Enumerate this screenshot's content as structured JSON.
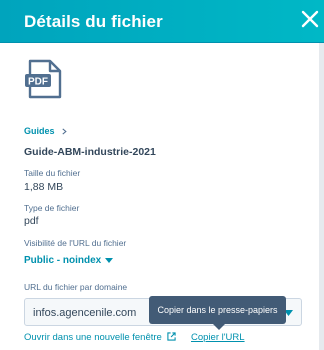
{
  "panel": {
    "title": "Détails du fichier",
    "close_icon": "close-icon"
  },
  "file": {
    "icon": "pdf-file-icon",
    "icon_text": "PDF",
    "breadcrumb": "Guides",
    "name": "Guide-ABM-industrie-2021",
    "size_label": "Taille du fichier",
    "size_value": "1,88 MB",
    "type_label": "Type de fichier",
    "type_value": "pdf"
  },
  "visibility": {
    "label": "Visibilité de l'URL du fichier",
    "value": "Public - noindex"
  },
  "domain": {
    "label": "URL du fichier par domaine",
    "selected": "infos.agencenile.com"
  },
  "tooltip": {
    "text": "Copier dans le presse-papiers"
  },
  "actions": {
    "open_new_window": "Ouvrir dans une nouvelle fenêtre",
    "copy_url": "Copier l'URL"
  },
  "colors": {
    "header": "#00a4bd",
    "link": "#0091ae",
    "text": "#33475b",
    "tooltip": "#425b76"
  }
}
